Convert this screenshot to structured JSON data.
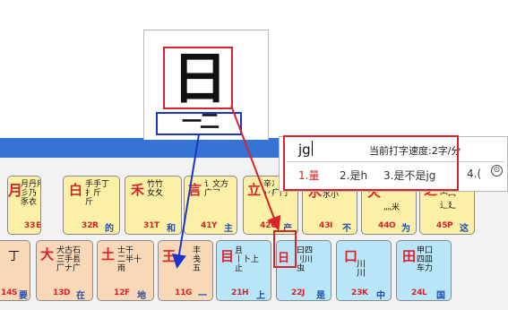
{
  "glyph": {
    "char": "日",
    "strokes": "一二"
  },
  "ime": {
    "input_code": "jg",
    "speed_text": "当前打字速度:2字/分",
    "candidates": [
      "1.量",
      "2.是h",
      "3.是不是jg",
      "4.("
    ],
    "more_symbol": "⊙"
  },
  "keys": {
    "r1_y": {
      "char": "月",
      "roots": "月丹用\n彡乃\n豕衣",
      "code": "33",
      "letter": "E",
      "zi": "有"
    },
    "r1_t": {
      "char": "白",
      "roots": "手手丁\n扌斤\n斤",
      "code": "32",
      "letter": "R",
      "zi": "的"
    },
    "r1_r": {
      "char": "禾",
      "roots": "竹竹\n女夂",
      "code": "31",
      "letter": "T",
      "zi": "和"
    },
    "r1_e": {
      "char": "言",
      "roots": "讠文方\n广乛",
      "code": "41",
      "letter": "Y",
      "zi": "主"
    },
    "r1_w": {
      "char": "立",
      "roots": "辛冫\n丷疒门",
      "code": "42",
      "letter": "U",
      "zi": "产"
    },
    "r1_q": {
      "char": "水",
      "roots": "氵小\n水小",
      "code": "43",
      "letter": "I",
      "zi": "不"
    },
    "r1_p": {
      "char": "火",
      "roots": "灬米",
      "code": "44",
      "letter": "O",
      "zi": "为"
    },
    "r1_a": {
      "char": "之",
      "roots": "宀冖\n辶廴",
      "code": "45",
      "letter": "P",
      "zi": "这"
    },
    "r2_a": {
      "char": "丁",
      "roots": "",
      "code": "14",
      "letter": "S",
      "zi": "要"
    },
    "r2_b": {
      "char": "大",
      "roots": "犬古石\n三手镸\n厂ナ广",
      "code": "13",
      "letter": "D",
      "zi": "在"
    },
    "r2_c": {
      "char": "土",
      "roots": "士干\n二半十\n雨",
      "code": "12",
      "letter": "F",
      "zi": "地"
    },
    "r2_d": {
      "char": "王",
      "roots": "丰\n戋\n五",
      "code": "11",
      "letter": "G",
      "zi": "一"
    },
    "r2_e": {
      "char": "目",
      "roots": "且\n丨卜上\n止",
      "code": "21",
      "letter": "H",
      "zi": "上"
    },
    "r2_f": {
      "char": "日",
      "roots": "曰四\n刂川\n虫",
      "code": "22",
      "letter": "J",
      "zi": "是"
    },
    "r2_g": {
      "char": "口",
      "roots": "川\n川",
      "code": "23",
      "letter": "K",
      "zi": "中"
    },
    "r2_h": {
      "char": "田",
      "roots": "甲囗\n四皿\n车力",
      "code": "24",
      "letter": "L",
      "zi": "国"
    }
  }
}
